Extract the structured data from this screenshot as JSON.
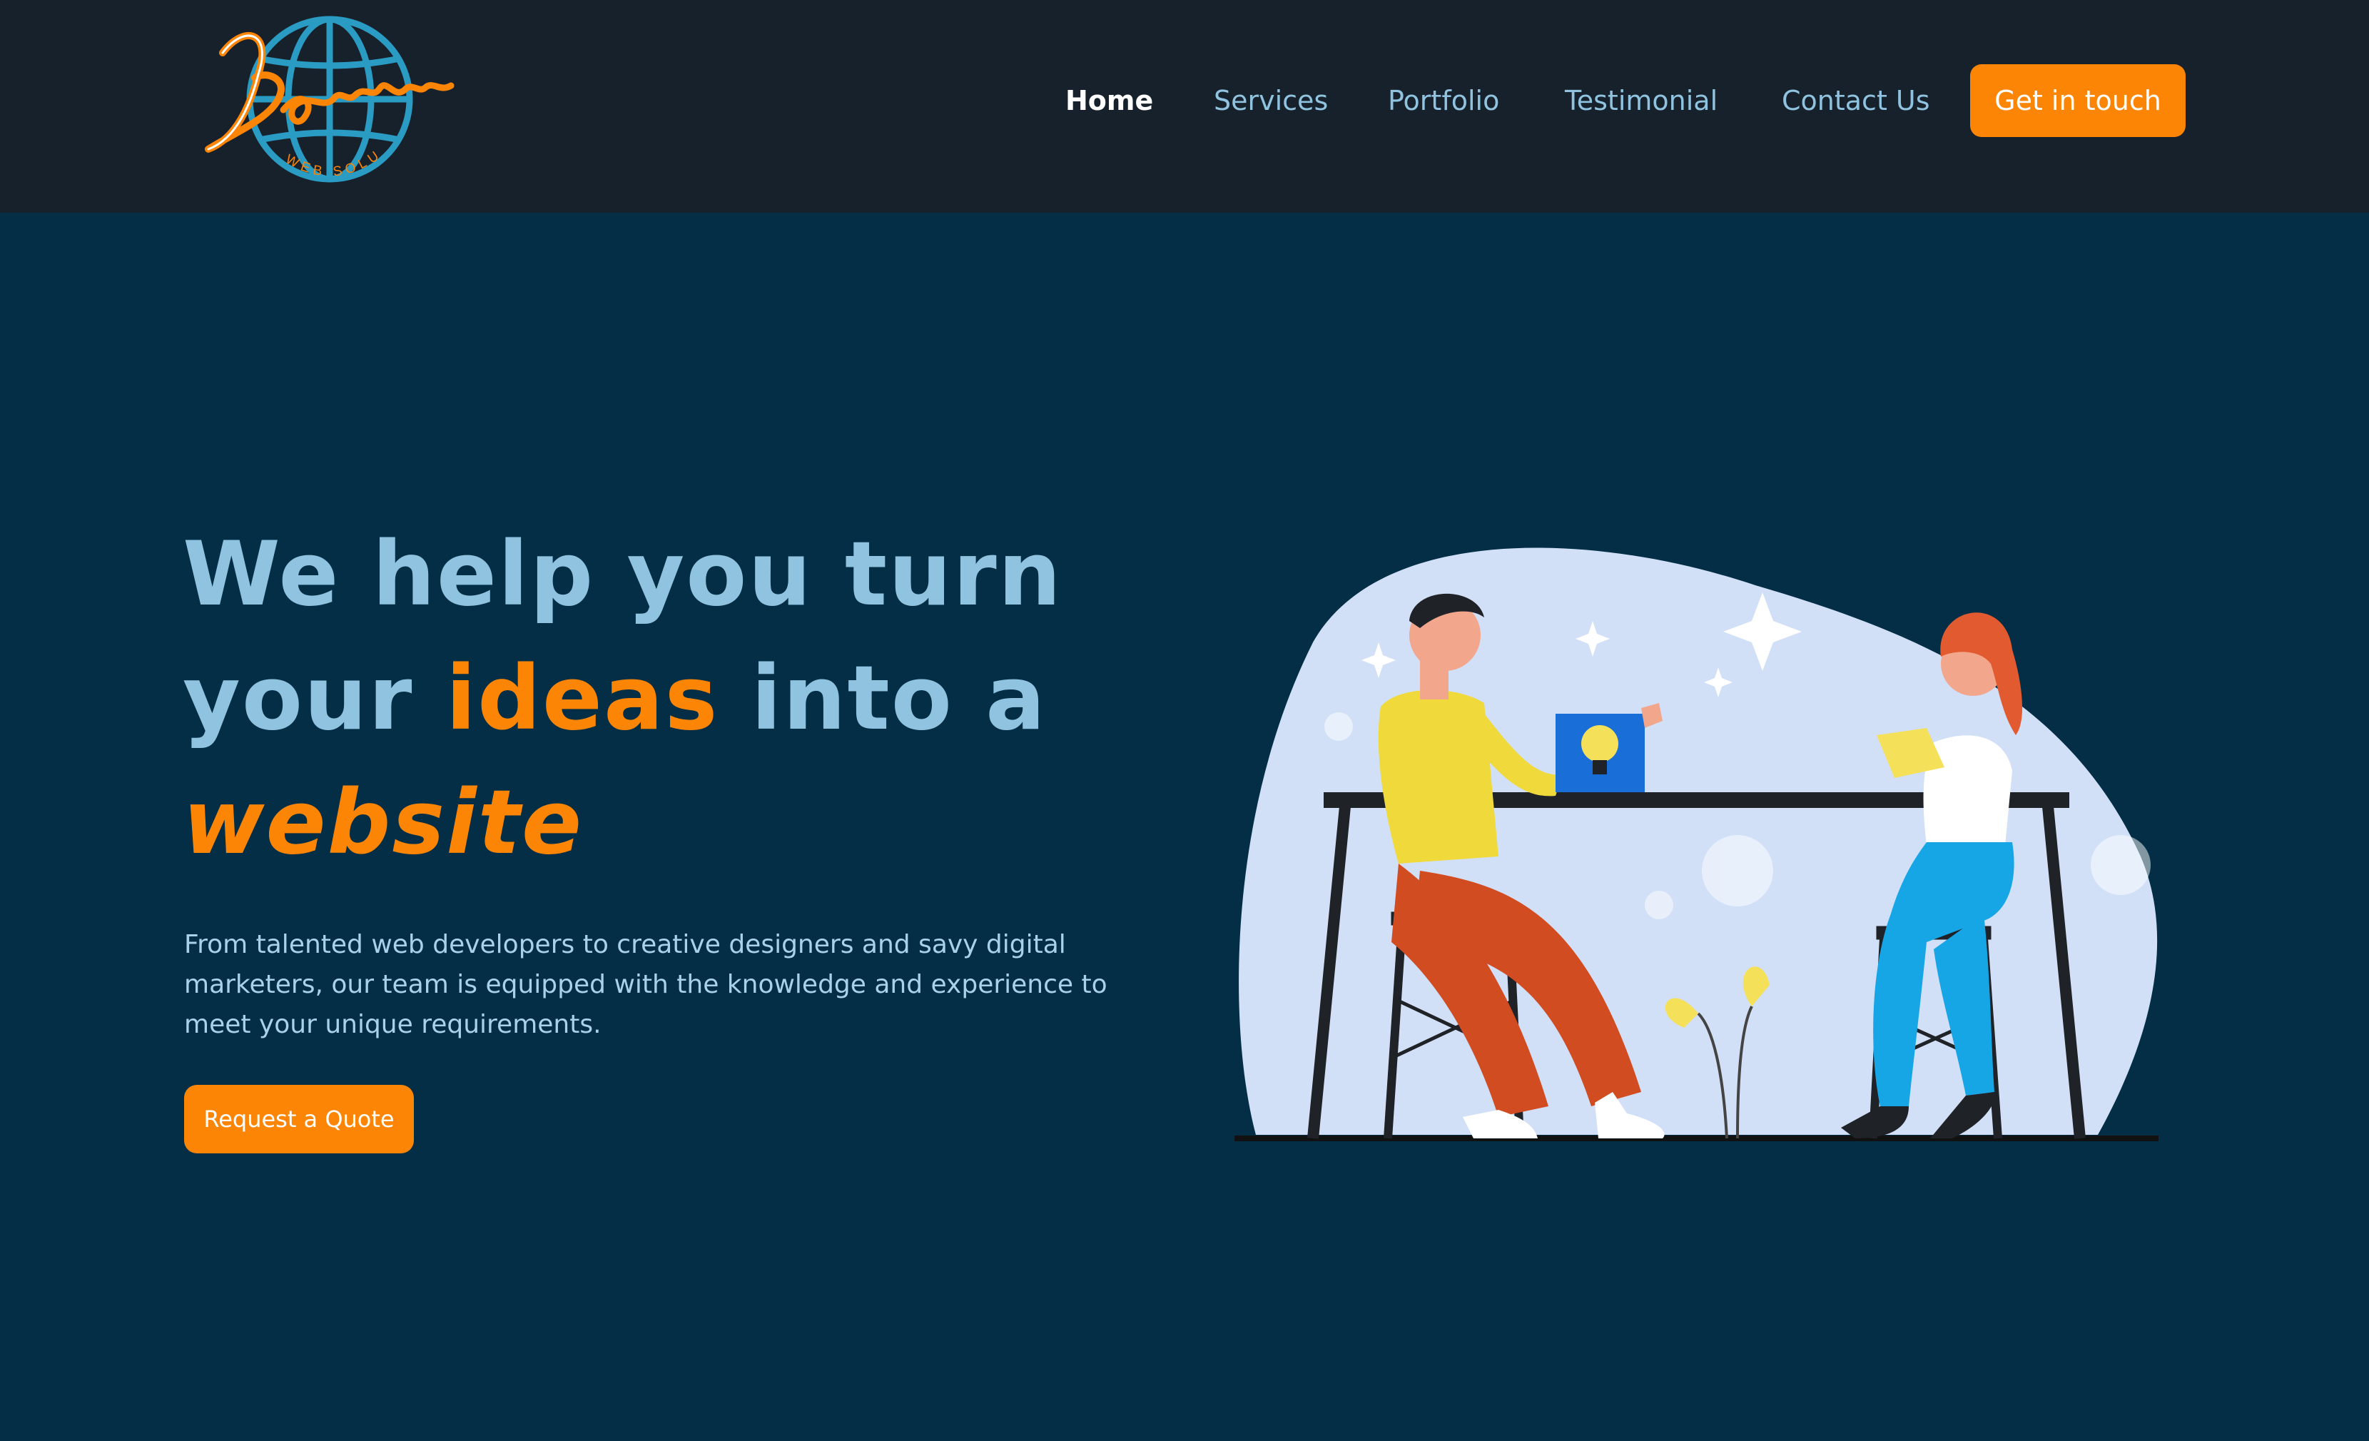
{
  "brand": {
    "logo_text": "Bongomin",
    "logo_subtext": "WEB SOLUTIONS"
  },
  "nav": {
    "items": [
      {
        "label": "Home",
        "active": true
      },
      {
        "label": "Services",
        "active": false
      },
      {
        "label": "Portfolio",
        "active": false
      },
      {
        "label": "Testimonial",
        "active": false
      },
      {
        "label": "Contact Us",
        "active": false
      }
    ],
    "cta_label": "Get in touch"
  },
  "hero": {
    "title_part1": "We help you turn",
    "title_part2": "your",
    "title_accent1": "ideas",
    "title_part3": "into a",
    "title_accent2": "website",
    "description": "From talented web developers to creative designers and savy digital marketers, our team is equipped with the knowledge and experience to meet your unique requirements.",
    "cta_label": "Request a Quote"
  },
  "colors": {
    "header_bg": "#17212b",
    "page_bg": "#032e45",
    "accent": "#fd8505",
    "text_light_blue": "#8fc3e0",
    "illustration_blob": "#d1e0f7"
  },
  "icons": {
    "logo": "globe-logo-icon",
    "illustration": "team-meeting-illustration"
  }
}
